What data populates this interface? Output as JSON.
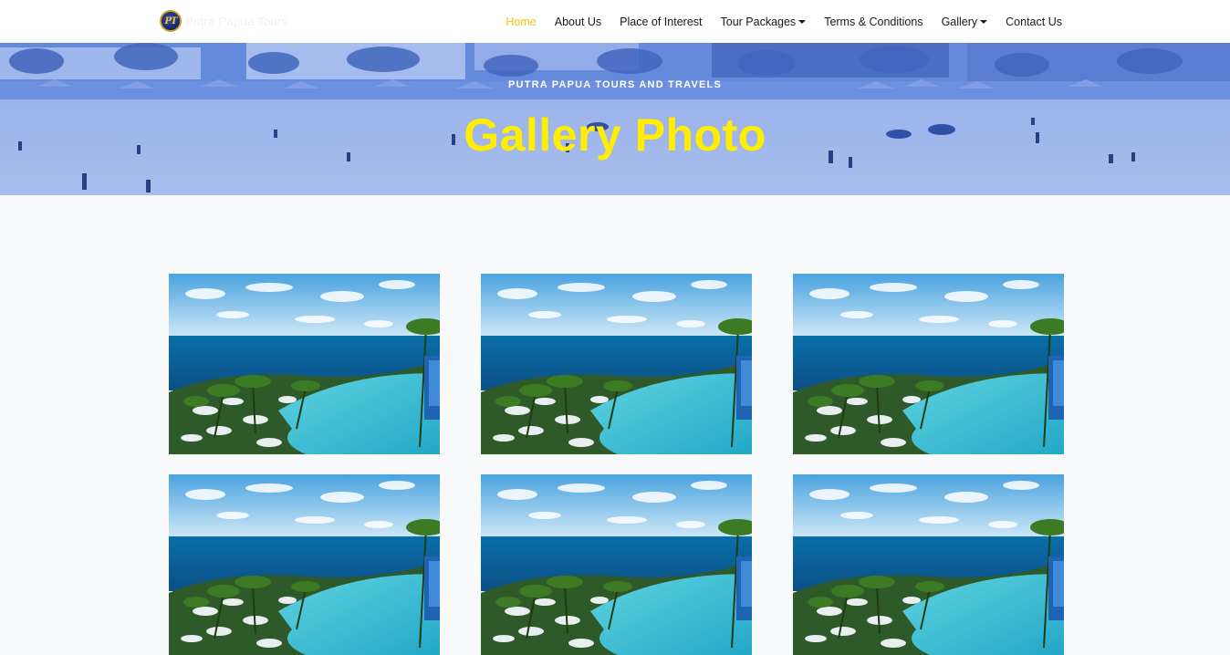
{
  "brand": {
    "logo_monogram": "PT",
    "name": "Putra Papua Tours"
  },
  "nav": {
    "items": [
      {
        "label": "Home",
        "active": true,
        "dropdown": false
      },
      {
        "label": "About Us",
        "active": false,
        "dropdown": false
      },
      {
        "label": "Place of Interest",
        "active": false,
        "dropdown": false
      },
      {
        "label": "Tour Packages",
        "active": false,
        "dropdown": true
      },
      {
        "label": "Terms & Conditions",
        "active": false,
        "dropdown": false
      },
      {
        "label": "Gallery",
        "active": false,
        "dropdown": true
      },
      {
        "label": "Contact Us",
        "active": false,
        "dropdown": false
      }
    ]
  },
  "hero": {
    "subtitle": "PUTRA PAPUA TOURS AND TRAVELS",
    "title": "Gallery Photo"
  },
  "gallery": {
    "photos": [
      {
        "subject": "resort-pool-ocean"
      },
      {
        "subject": "resort-pool-ocean"
      },
      {
        "subject": "resort-pool-ocean"
      },
      {
        "subject": "resort-pool-ocean"
      },
      {
        "subject": "resort-pool-ocean"
      },
      {
        "subject": "resort-pool-ocean"
      }
    ]
  },
  "colors": {
    "accent_active": "#f1c40f",
    "hero_title": "#ffee00",
    "hero_overlay": "#5b86e5"
  }
}
